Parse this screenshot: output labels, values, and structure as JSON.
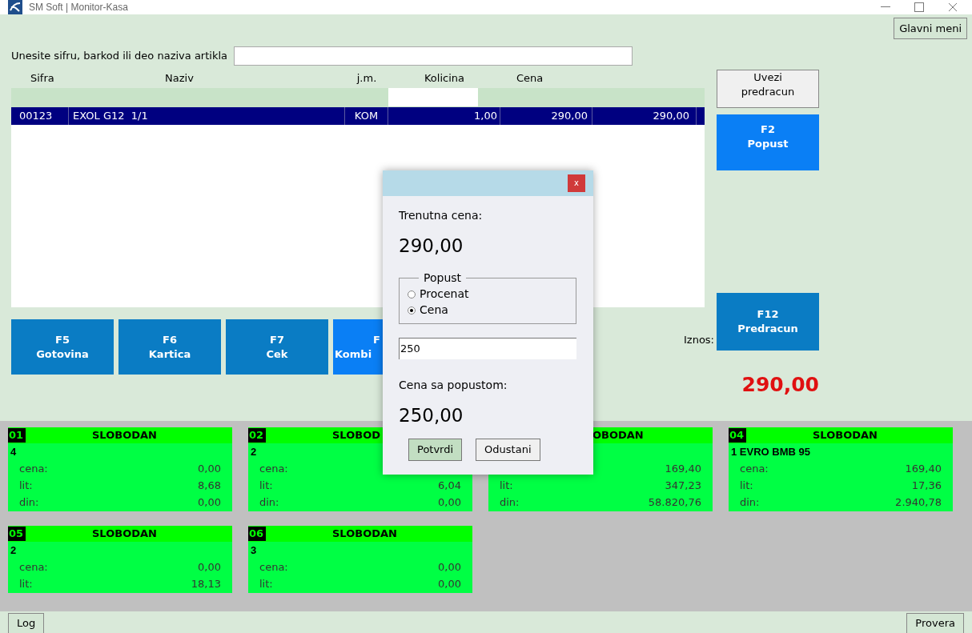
{
  "window": {
    "title": "SM Soft | Monitor-Kasa"
  },
  "main_menu_button": "Glavni meni",
  "search": {
    "label": "Unesite sifru, barkod ili deo naziva artikla"
  },
  "table": {
    "columns": [
      "Sifra",
      "Naziv",
      "j.m.",
      "Kolicina",
      "Cena"
    ],
    "rows": [
      {
        "cells": [
          "00123",
          "EXOL G12  1/1",
          "KOM",
          "1,00",
          "290,00",
          "290,00"
        ],
        "selected": true
      }
    ]
  },
  "side_buttons": [
    {
      "kind": "plain",
      "lines": [
        "Uvezi",
        "predracun"
      ]
    },
    {
      "kind": "bright",
      "lines": [
        "F2",
        "Popust"
      ]
    },
    {
      "kind": "dark",
      "lines": [
        "F12",
        "Predracun"
      ]
    }
  ],
  "payment_buttons": [
    {
      "kind": "full",
      "key": "F5",
      "label": "Gotovina"
    },
    {
      "kind": "full",
      "key": "F6",
      "label": "Kartica"
    },
    {
      "kind": "full",
      "key": "F7",
      "label": "Cek"
    },
    {
      "kind": "partial",
      "key": "F",
      "label": "Kombi"
    }
  ],
  "total": {
    "label": "Iznos:",
    "value": "290,00"
  },
  "pumps": [
    {
      "number": "01",
      "status": "SLOBODAN",
      "name": "4",
      "rows": [
        {
          "label": "cena:",
          "value": "0,00"
        },
        {
          "label": "lit:",
          "value": "8,68"
        },
        {
          "label": "din:",
          "value": "0,00"
        }
      ]
    },
    {
      "number": "02",
      "status": "SLOBOD",
      "name": "2",
      "rows": [
        {
          "label": "cena:"
        },
        {
          "label": "lit:",
          "value": "6,04"
        },
        {
          "label": "din:",
          "value": "0,00"
        }
      ]
    },
    {
      "status": "OBODAN",
      "rows": [
        {
          "value": "169,40"
        },
        {
          "label": "lit:",
          "value": "347,23"
        },
        {
          "label": "din:",
          "value": "58.820,76"
        }
      ]
    },
    {
      "number": "04",
      "status": "SLOBODAN",
      "name": "1 EVRO BMB 95",
      "rows": [
        {
          "label": "cena:",
          "value": "169,40"
        },
        {
          "label": "lit:",
          "value": "17,36"
        },
        {
          "label": "din:",
          "value": "2.940,78"
        }
      ]
    },
    {
      "number": "05",
      "status": "SLOBODAN",
      "name": "2",
      "rows": [
        {
          "label": "cena:",
          "value": "0,00"
        },
        {
          "label": "lit:",
          "value": "18,13"
        }
      ]
    },
    {
      "number": "06",
      "status": "SLOBODAN",
      "name": "3",
      "rows": [
        {
          "label": "cena:",
          "value": "0,00"
        },
        {
          "label": "lit:",
          "value": "0,00"
        }
      ]
    }
  ],
  "bottom_buttons": [
    "Log",
    "Provera"
  ],
  "dialog": {
    "close": "x",
    "current_label": "Trenutna cena:",
    "current_value": "290,00",
    "group": {
      "title": "Popust",
      "options": [
        {
          "label": "Procenat",
          "selected": false
        },
        {
          "label": "Cena",
          "selected": true
        }
      ]
    },
    "input_value": "250",
    "result_label": "Cena sa popustom:",
    "result_value": "250,00",
    "buttons": [
      {
        "label": "Potvrdi",
        "kind": "primary"
      },
      {
        "label": "Odustani",
        "kind": "secondary"
      }
    ]
  }
}
